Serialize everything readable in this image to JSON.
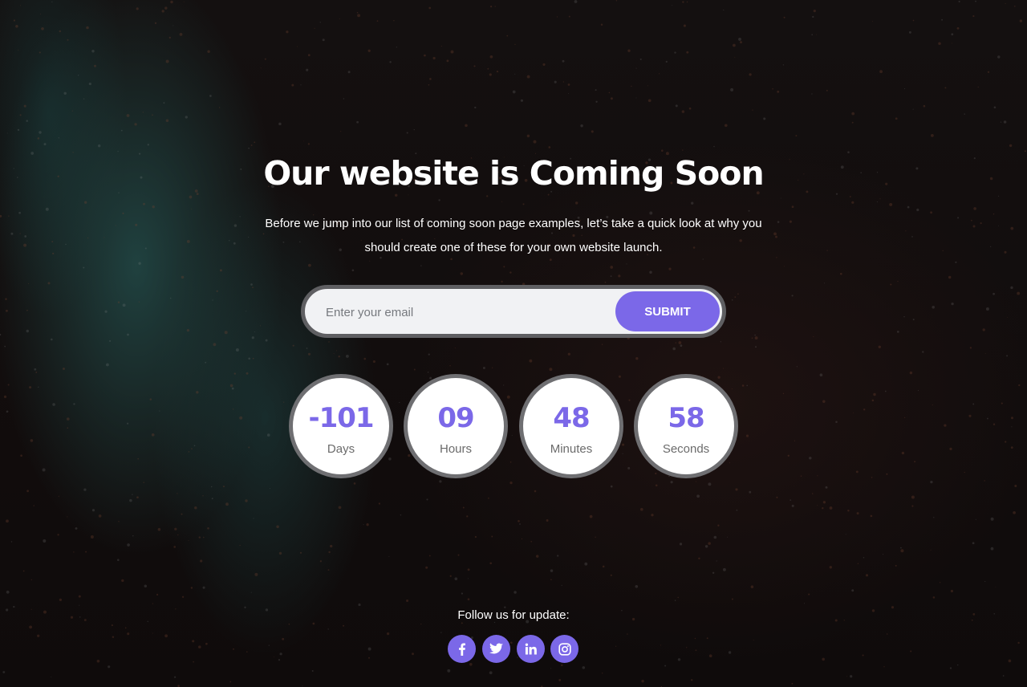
{
  "header": {
    "title": "Our website is Coming Soon",
    "subtitle": "Before we jump into our list of coming soon page examples, let’s take a quick look at why you should create one of these for your own website launch."
  },
  "subscribe": {
    "email_placeholder": "Enter your email",
    "submit_label": "SUBMIT"
  },
  "countdown": [
    {
      "value": "-101",
      "label": "Days"
    },
    {
      "value": "09",
      "label": "Hours"
    },
    {
      "value": "48",
      "label": "Minutes"
    },
    {
      "value": "58",
      "label": "Seconds"
    }
  ],
  "footer": {
    "follow_text": "Follow us for update:",
    "socials": [
      {
        "icon": "facebook-icon"
      },
      {
        "icon": "twitter-icon"
      },
      {
        "icon": "linkedin-icon"
      },
      {
        "icon": "instagram-icon"
      }
    ]
  },
  "colors": {
    "accent": "#7b68e8",
    "circle_border": "#6f6f72",
    "background": "#0d0a0a"
  }
}
